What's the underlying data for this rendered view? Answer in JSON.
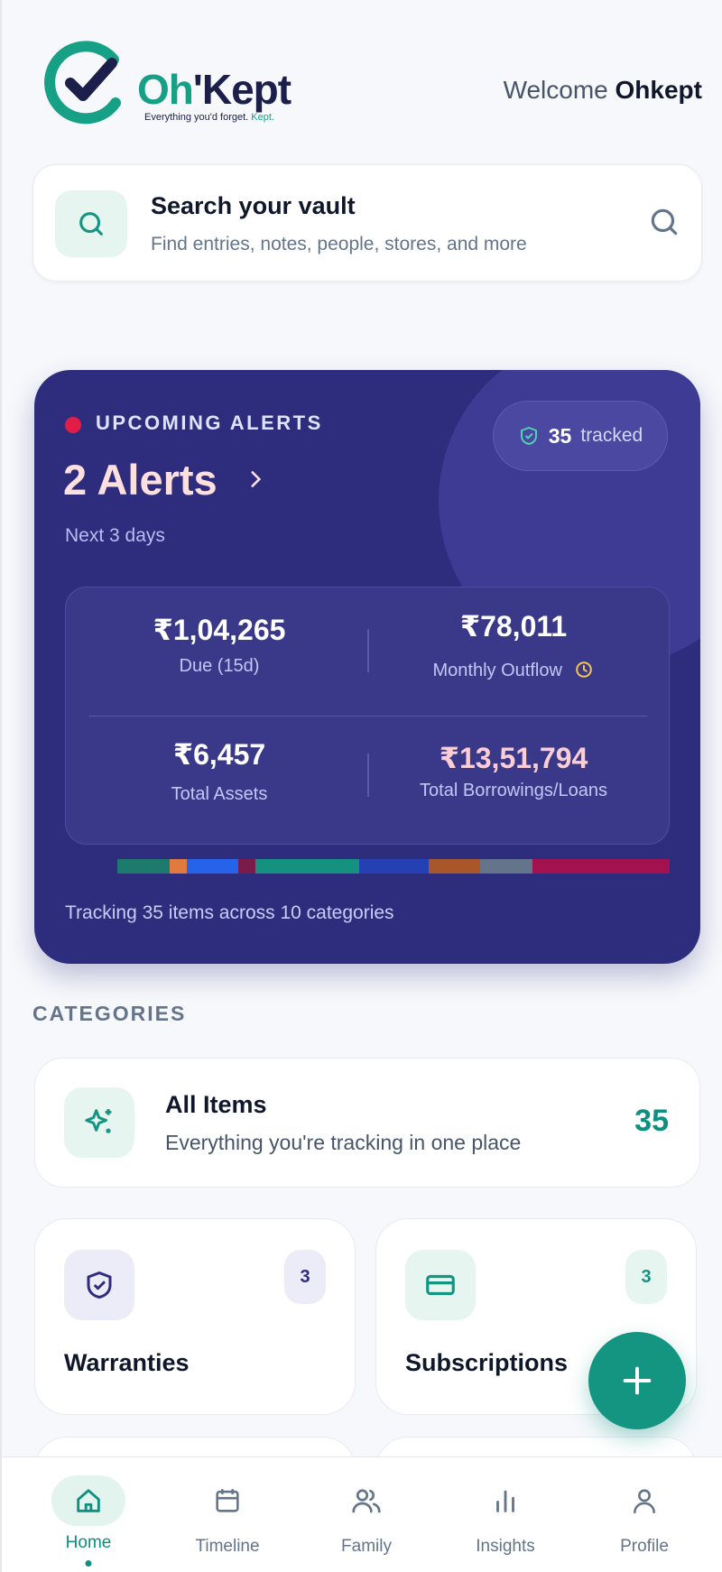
{
  "header": {
    "logo_name_oh": "Oh",
    "logo_name_kept": "Kept",
    "tagline": "Everything you'd forget.",
    "tagline_accent": "Kept.",
    "welcome_prefix": "Welcome",
    "username": "Ohkept"
  },
  "search": {
    "title": "Search your vault",
    "subtitle": "Find entries, notes, people, stores, and more"
  },
  "alerts": {
    "label": "UPCOMING ALERTS",
    "count_text": "2 Alerts",
    "window": "Next 3 days",
    "tracked_count": "35",
    "tracked_label": "tracked",
    "stats": {
      "due_value": "₹1,04,265",
      "due_label": "Due (15d)",
      "outflow_value": "₹78,011",
      "outflow_label": "Monthly Outflow",
      "assets_value": "₹6,457",
      "assets_label": "Total Assets",
      "loans_value": "₹13,51,794",
      "loans_label": "Total Borrowings/Loans"
    },
    "category_bar": [
      {
        "color": "#1f7a6e",
        "share": 0.094
      },
      {
        "color": "#e07a3f",
        "share": 0.031
      },
      {
        "color": "#2563eb",
        "share": 0.094
      },
      {
        "color": "#7a1c4a",
        "share": 0.031
      },
      {
        "color": "#14917f",
        "share": 0.188
      },
      {
        "color": "#2540b5",
        "share": 0.125
      },
      {
        "color": "#a8562a",
        "share": 0.094
      },
      {
        "color": "#64748b",
        "share": 0.094
      },
      {
        "color": "#a3124f",
        "share": 0.249
      }
    ],
    "tracking_text": "Tracking 35 items across 10 categories"
  },
  "categories": {
    "heading": "CATEGORIES",
    "all_items": {
      "title": "All Items",
      "subtitle": "Everything you're tracking in one place",
      "count": "35"
    },
    "tiles": [
      {
        "name": "Warranties",
        "count": "3"
      },
      {
        "name": "Subscriptions",
        "count": "3"
      }
    ]
  },
  "nav": {
    "items": [
      {
        "label": "Home"
      },
      {
        "label": "Timeline"
      },
      {
        "label": "Family"
      },
      {
        "label": "Insights"
      },
      {
        "label": "Profile"
      }
    ]
  },
  "colors": {
    "brand": "#149582",
    "navy": "#2e2c7d",
    "alert_dot": "#e11d48"
  }
}
